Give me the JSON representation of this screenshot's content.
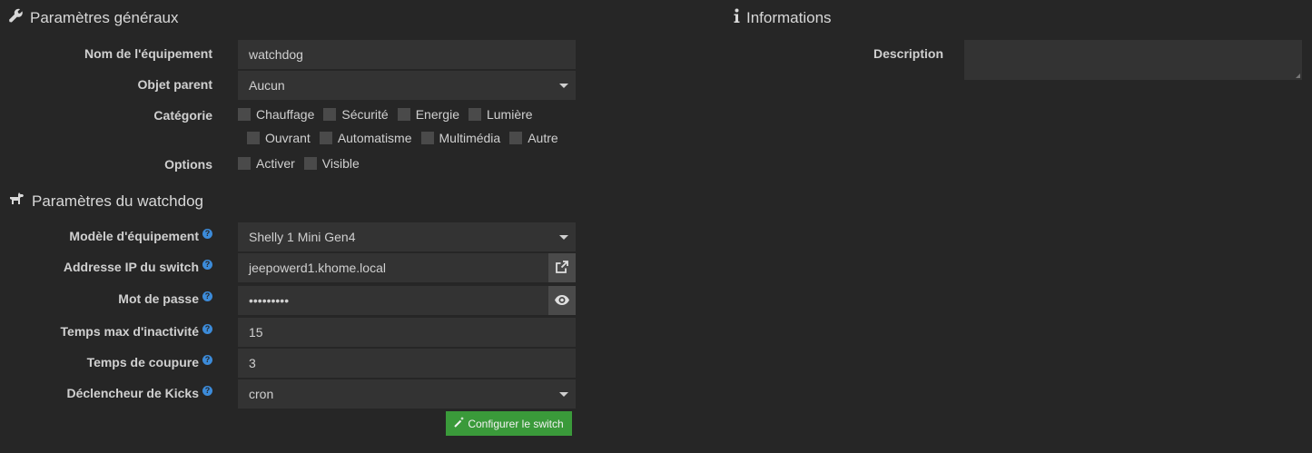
{
  "general": {
    "title": "Paramètres généraux",
    "title_icon": "wrench-icon",
    "name_label": "Nom de l'équipement",
    "name_value": "watchdog",
    "parent_label": "Objet parent",
    "parent_value": "Aucun",
    "category_label": "Catégorie",
    "categories_row1": [
      "Chauffage",
      "Sécurité",
      "Energie",
      "Lumière"
    ],
    "categories_row2": [
      "Ouvrant",
      "Automatisme",
      "Multimédia",
      "Autre"
    ],
    "options_label": "Options",
    "options": [
      "Activer",
      "Visible"
    ]
  },
  "watchdog": {
    "title": "Paramètres du watchdog",
    "title_icon": "dog-icon",
    "model_label": "Modèle d'équipement",
    "model_value": "Shelly 1 Mini Gen4",
    "ip_label": "Addresse IP du switch",
    "ip_value": "jeepowerd1.khome.local",
    "password_label": "Mot de passe",
    "password_value": "•••••••••",
    "idle_label": "Temps max d'inactivité",
    "idle_value": "15",
    "cut_label": "Temps de coupure",
    "cut_value": "3",
    "trigger_label": "Déclencheur de Kicks",
    "trigger_value": "cron",
    "configure_button": "Configurer le switch",
    "help_glyph": "?"
  },
  "info": {
    "title": "Informations",
    "title_icon": "info-icon",
    "description_label": "Description",
    "description_value": ""
  },
  "colors": {
    "background": "#262626",
    "field": "#333333",
    "button_green": "#3a9a3a",
    "help_blue": "#3c8bd9"
  }
}
